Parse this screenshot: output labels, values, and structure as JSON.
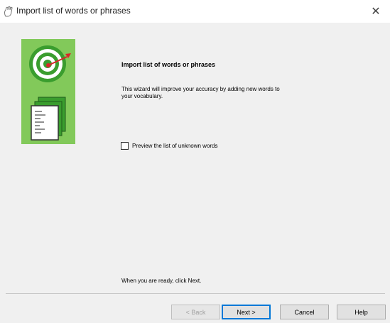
{
  "window": {
    "title": "Import list of words or phrases",
    "close_glyph": "✕",
    "app_icon": "speech-hand-icon"
  },
  "wizard": {
    "heading": "Import list of words or phrases",
    "intro": "This wizard will improve your accuracy by adding new words to your vocabulary.",
    "preview_checkbox": {
      "label": "Preview the list of unknown words",
      "checked": false
    },
    "ready_text": "When you are ready, click Next.",
    "illustration": "target-and-documents-icon"
  },
  "buttons": {
    "back": "< Back",
    "next": "Next >",
    "cancel": "Cancel",
    "help": "Help"
  },
  "colors": {
    "illustration_green": "#82c95a",
    "target_green": "#3a9d2e",
    "dart_red": "#d9262a",
    "default_button_border": "#0078d7"
  }
}
